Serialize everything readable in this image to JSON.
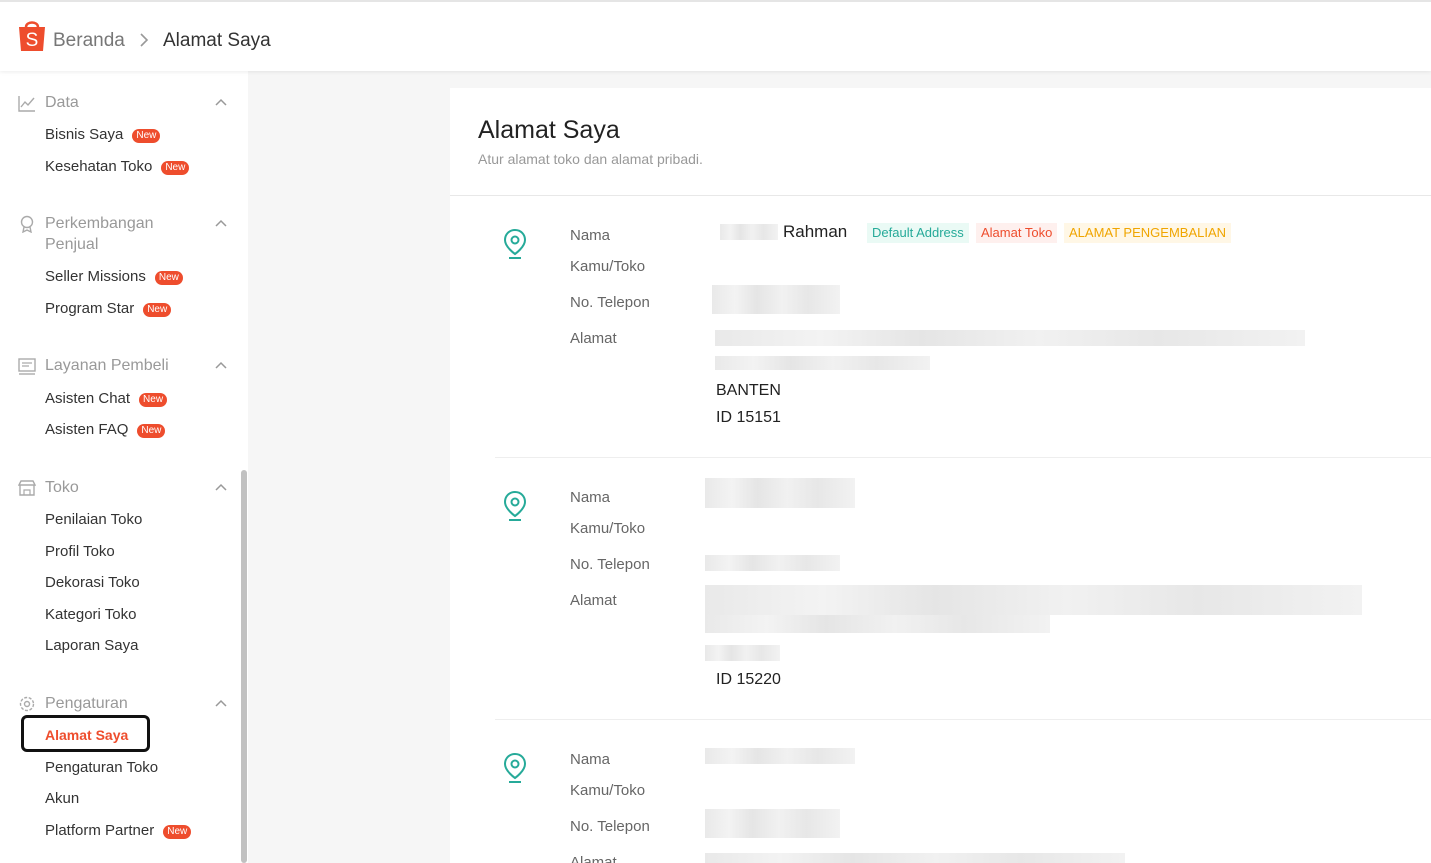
{
  "header": {
    "breadcrumb_home": "Beranda",
    "breadcrumb_current": "Alamat Saya",
    "brand_color": "#ee4d2d"
  },
  "sidebar": {
    "badge_text": "New",
    "groups": [
      {
        "label": "Data",
        "icon": "chart-line-icon",
        "items": [
          {
            "label": "Bisnis Saya",
            "badge": true
          },
          {
            "label": "Kesehatan Toko",
            "badge": true
          }
        ]
      },
      {
        "label": "Perkembangan Penjual",
        "icon": "seller-growth-icon",
        "items": [
          {
            "label": "Seller Missions",
            "badge": true
          },
          {
            "label": "Program Star",
            "badge": true
          }
        ]
      },
      {
        "label": "Layanan Pembeli",
        "icon": "chat-box-icon",
        "items": [
          {
            "label": "Asisten Chat",
            "badge": true
          },
          {
            "label": "Asisten FAQ",
            "badge": true
          }
        ]
      },
      {
        "label": "Toko",
        "icon": "shop-icon",
        "items": [
          {
            "label": "Penilaian Toko"
          },
          {
            "label": "Profil Toko"
          },
          {
            "label": "Dekorasi Toko"
          },
          {
            "label": "Kategori Toko"
          },
          {
            "label": "Laporan Saya"
          }
        ]
      },
      {
        "label": "Pengaturan",
        "icon": "gear-icon",
        "items": [
          {
            "label": "Alamat Saya",
            "active": true
          },
          {
            "label": "Pengaturan Toko"
          },
          {
            "label": "Akun"
          },
          {
            "label": "Platform Partner",
            "badge": true
          }
        ]
      }
    ]
  },
  "main": {
    "title": "Alamat Saya",
    "subtitle": "Atur alamat toko dan alamat pribadi.",
    "labels": {
      "name_line1": "Nama",
      "name_line2": "Kamu/Toko",
      "phone": "No. Telepon",
      "address": "Alamat"
    },
    "addresses": [
      {
        "name": "Rahman",
        "tags": [
          "Default Address",
          "Alamat Toko",
          "ALAMAT PENGEMBALIAN"
        ],
        "region": "BANTEN",
        "postal": "ID 15151"
      },
      {
        "name": "",
        "tags": [],
        "region": "",
        "postal": "ID 15220"
      },
      {
        "name": "",
        "tags": [],
        "region": "",
        "postal": ""
      }
    ],
    "accent_color": "#26aa99"
  }
}
